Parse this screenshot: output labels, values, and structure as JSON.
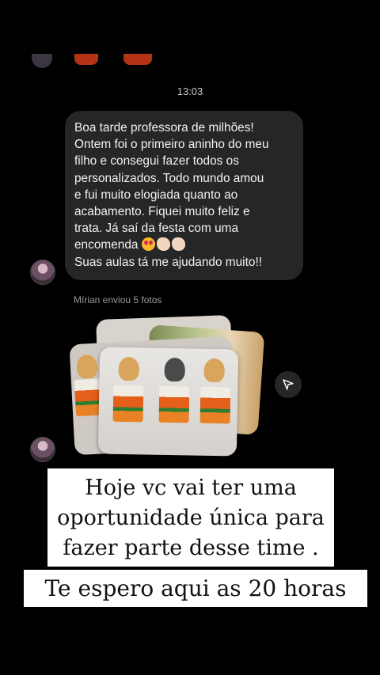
{
  "chat": {
    "timestamp": "13:03",
    "message_lines": [
      "Boa tarde professora de milhões!",
      "Ontem foi o primeiro aninho do meu",
      "filho e consegui fazer todos os",
      "personalizados.  Todo mundo amou",
      "e fui muito elogiada quanto ao",
      "acabamento. Fiquei muito feliz e",
      "trata. Já saí da festa com uma",
      "encomenda",
      "Suas aulas tá me ajudando muito!!"
    ],
    "emojis": [
      "smiling-face-with-heart-eyes-icon",
      "clapping-hands-icon",
      "clapping-hands-icon"
    ],
    "photos_label": "Mírian enviou 5 fotos"
  },
  "banners": {
    "offer_lines": [
      "Hoje vc vai ter uma",
      "oportunidade única para",
      "fazer parte desse time ."
    ],
    "invite": "Te espero aqui as 20 horas"
  },
  "colors": {
    "background": "#000000",
    "bubble": "#262626",
    "banner_bg": "#ffffff",
    "banner_text": "#111111"
  }
}
